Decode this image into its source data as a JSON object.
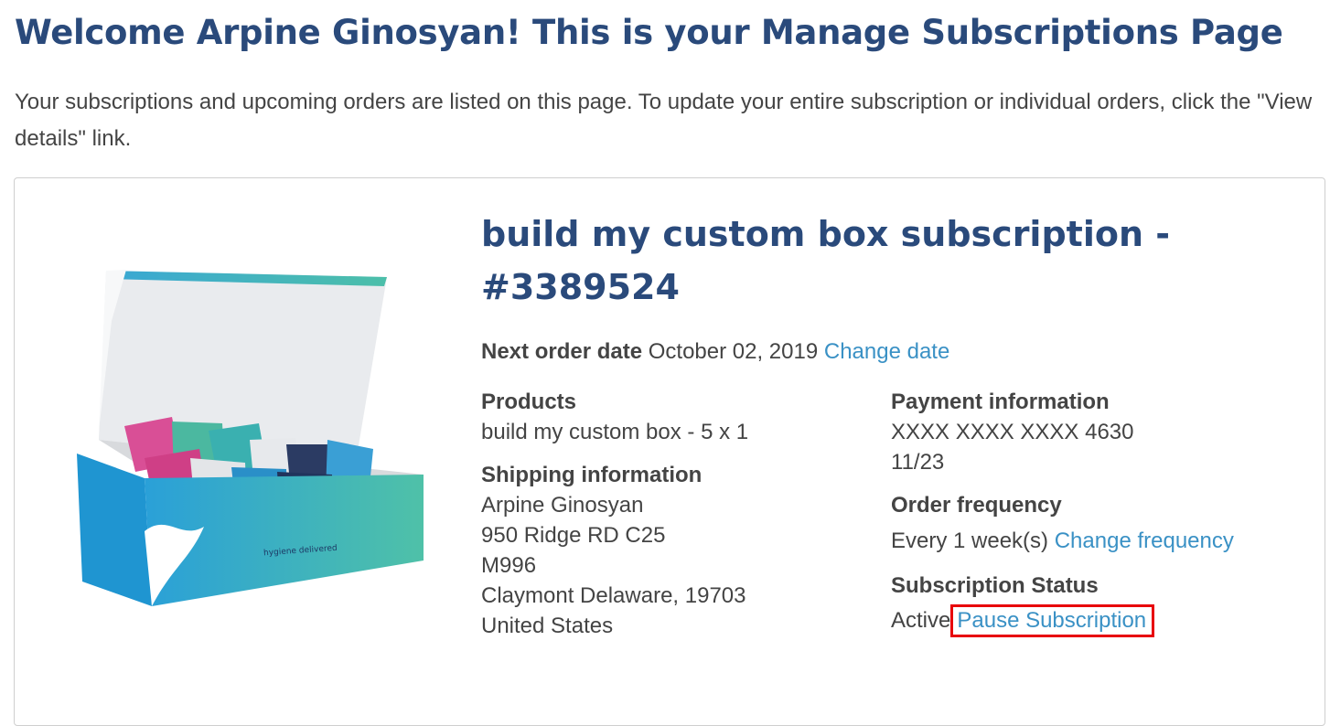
{
  "header": {
    "title": "Welcome Arpine Ginosyan! This is your Manage Subscriptions Page",
    "intro": "Your subscriptions and upcoming orders are listed on this page. To update your entire subscription or individual orders, click the \"View details\" link."
  },
  "subscription": {
    "title": "build my custom box subscription - #3389524",
    "image_caption": "hygiene delivered",
    "next_order_label": "Next order date",
    "next_order_date": "October 02, 2019",
    "change_date_link": "Change date",
    "products_label": "Products",
    "product_line": "build my custom box - 5 x 1",
    "shipping_label": "Shipping information",
    "shipping_lines": [
      "Arpine Ginosyan",
      "950 Ridge RD C25",
      "M996",
      "Claymont Delaware, 19703",
      "United States"
    ],
    "payment_label": "Payment information",
    "card_number": "XXXX XXXX XXXX 4630",
    "card_expiry": "11/23",
    "frequency_label": "Order frequency",
    "frequency_value": "Every 1 week(s)",
    "change_frequency_link": "Change frequency",
    "status_label": "Subscription Status",
    "status_value": "Active",
    "pause_link": "Pause Subscription"
  },
  "colors": {
    "heading": "#2a4a7b",
    "link": "#3a91c5",
    "highlight": "#e8000a",
    "box_gradient": [
      "#2aa0d8",
      "#4fc1a8"
    ],
    "packet_pink": "#d94f96"
  }
}
